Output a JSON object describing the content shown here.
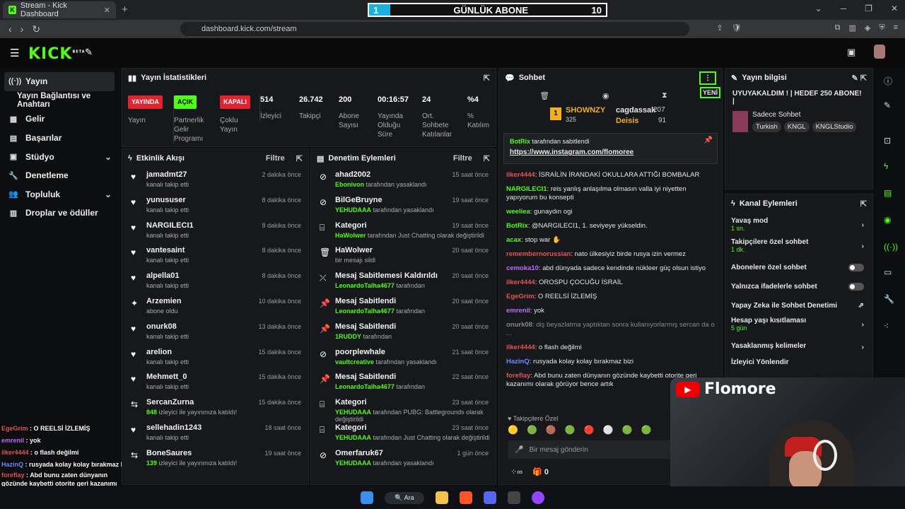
{
  "browser": {
    "tab_title": "Stream - Kick Dashboard",
    "url": "dashboard.kick.com/stream"
  },
  "overlay_banner": {
    "progress": "1",
    "title": "GÜNLÜK ABONE",
    "goal": "10"
  },
  "header": {
    "logo": "KICK",
    "beta": "BETA"
  },
  "nav": {
    "items": [
      {
        "label": "Yayın",
        "icon": "broadcast-icon"
      },
      {
        "label": "Yayın Bağlantısı ve Anahtarı"
      },
      {
        "label": "Gelir",
        "icon": "revenue-icon"
      },
      {
        "label": "Başarılar",
        "icon": "achievements-icon"
      },
      {
        "label": "Stüdyo",
        "icon": "studio-icon"
      },
      {
        "label": "Denetleme",
        "icon": "moderation-icon"
      },
      {
        "label": "Topluluk",
        "icon": "community-icon"
      },
      {
        "label": "Droplar ve ödüller",
        "icon": "drops-icon"
      }
    ]
  },
  "stats": {
    "title": "Yayın İstatistikleri",
    "items": [
      {
        "badge": "YAYINDA",
        "label": "Yayın"
      },
      {
        "badge": "AÇIK",
        "label": "Partnerlik Gelir Programı"
      },
      {
        "badge": "KAPALI",
        "label": "Çoklu Yayın"
      },
      {
        "value": "514",
        "label": "İzleyici"
      },
      {
        "value": "26.742",
        "label": "Takipçi"
      },
      {
        "value": "200",
        "label": "Abone Sayısı"
      },
      {
        "value": "00:16:57",
        "label": "Yayında Olduğu Süre"
      },
      {
        "value": "24",
        "label": "Ort. Sohbete Katılanlar"
      },
      {
        "value": "%4",
        "label": "% Katılım"
      }
    ]
  },
  "activity": {
    "title": "Etkinlik Akışı",
    "filter": "Filtre",
    "rows": [
      {
        "name": "jamadmt27",
        "sub": "kanalı takip etti",
        "time": "2 dakika önce"
      },
      {
        "name": "yunususer",
        "sub": "kanalı takip etti",
        "time": "8 dakika önce"
      },
      {
        "name": "NARGILECI1",
        "sub": "kanalı takip etti",
        "time": "8 dakika önce"
      },
      {
        "name": "vantesaint",
        "sub": "kanalı takip etti",
        "time": "8 dakika önce"
      },
      {
        "name": "alpella01",
        "sub": "kanalı takip etti",
        "time": "8 dakika önce"
      },
      {
        "name": "Arzemien",
        "sub": "abone oldu",
        "time": "10 dakika önce"
      },
      {
        "name": "onurk08",
        "sub": "kanalı takip etti",
        "time": "13 dakika önce"
      },
      {
        "name": "arelion",
        "sub": "kanalı takip etti",
        "time": "15 dakika önce"
      },
      {
        "name": "Mehmett_0",
        "sub": "kanalı takip etti",
        "time": "15 dakika önce"
      },
      {
        "name": "SercanZurna",
        "sub_hl": "848",
        "sub": " izleyici ile yayınınıza katıldı!",
        "time": "15 dakika önce"
      },
      {
        "name": "sellehadin1243",
        "sub": "kanalı takip etti",
        "time": "18 saat önce"
      },
      {
        "name": "BoneSaures",
        "sub_hl": "139",
        "sub": " izleyici ile yayınınıza katıldı!",
        "time": "19 saat önce"
      }
    ]
  },
  "modlog": {
    "title": "Denetim Eylemleri",
    "filter": "Filtre",
    "rows": [
      {
        "name": "ahad2002",
        "hl": "Ebonivon",
        "sub": " tarafından yasaklandı",
        "time": "15 saat önce"
      },
      {
        "name": "BilGeBruyne",
        "hl": "YEHUDAAA",
        "sub": " tarafından yasaklandı",
        "time": "19 saat önce"
      },
      {
        "name": "Kategori",
        "hl": "HaWolwer",
        "sub": " tarafından Just Chatting olarak değiştirildi",
        "time": "19 saat önce"
      },
      {
        "name": "HaWolwer",
        "hl": "",
        "sub": "bir mesajı sildi",
        "time": "20 saat önce"
      },
      {
        "name": "Mesaj Sabitlemesi Kaldırıldı",
        "hl": "LeonardoTalha4677",
        "sub": " tarafından",
        "time": "20 saat önce"
      },
      {
        "name": "Mesaj Sabitlendi",
        "hl": "LeonardoTalha4677",
        "sub": " tarafından",
        "time": "20 saat önce"
      },
      {
        "name": "Mesaj Sabitlendi",
        "hl": "1RUDDY",
        "sub": " tarafından",
        "time": "20 saat önce"
      },
      {
        "name": "poorplewhale",
        "hl": "vaultcreative",
        "sub": " tarafından yasaklandı",
        "time": "21 saat önce"
      },
      {
        "name": "Mesaj Sabitlendi",
        "hl": "LeonardoTalha4677",
        "sub": " tarafından",
        "time": "22 saat önce"
      },
      {
        "name": "Kategori",
        "hl": "YEHUDAAA",
        "sub": " tarafından PUBG: Battlegrounds olarak değiştirildi",
        "time": "23 saat önce"
      },
      {
        "name": "Kategori",
        "hl": "YEHUDAAA",
        "sub": " tarafından Just Chatting olarak değiştirildi",
        "time": "23 saat önce"
      },
      {
        "name": "Omerfaruk67",
        "hl": "YEHUDAAA",
        "sub": " tarafından yasaklandı",
        "time": "1 gün önce"
      }
    ]
  },
  "chat": {
    "title": "Sohbet",
    "new_label": "YENİ",
    "leader1": {
      "rank": "1",
      "name": "SHOWNZY",
      "value": "325"
    },
    "leader2": {
      "name": "cagdassak",
      "value": "207"
    },
    "leader3": {
      "name": "Deisis",
      "value": "91"
    },
    "pinned_by": "BotRix",
    "pinned_label": "tarafından sabitlendi",
    "pinned_link": "https://www.instagram.com/flomoree",
    "messages": [
      {
        "user": "ilker4444",
        "color": "#e25555",
        "text": "İSRAİLİN İRANDAKİ OKULLARA ATTIĞI BOMBALAR"
      },
      {
        "user": "NARGILECI1",
        "color": "#53fc18",
        "text": "reis yanlış anlaşılma olmasın valla iyi niyetten yapıyorum bu konsepti"
      },
      {
        "user": "weeliea",
        "color": "#53fc18",
        "text": "gunaydın ogi"
      },
      {
        "user": "BotRix",
        "color": "#53fc18",
        "text": "@NARGILECI1, 1. seviyeye yükseldin."
      },
      {
        "user": "acax",
        "color": "#53fc18",
        "text": "stop war ✋"
      },
      {
        "user": "remembernorussian",
        "color": "#e25555",
        "text": "nato ülkesiyiz birde rusya izin vermez"
      },
      {
        "user": "cemoka10",
        "color": "#c36bff",
        "text": "abd dünyada sadece kendinde nükleer güç olsun istiyo"
      },
      {
        "user": "ilker4444",
        "color": "#e25555",
        "text": "OROSPU ÇOCUĞU İSRAİL"
      },
      {
        "user": "EgeGrim",
        "color": "#e25555",
        "text": "O REELSİ İZLEMİŞ"
      },
      {
        "user": "emrenil",
        "color": "#c36bff",
        "text": "yok"
      },
      {
        "user": "onurk08",
        "color": "#888",
        "text": "diş beyazlatma yaptıktan sonra kullanıyorlarmış sercan da o ..."
      },
      {
        "user": "ilker4444",
        "color": "#e25555",
        "text": "o flash değilmi"
      },
      {
        "user": "HazinQ",
        "color": "#6b8cff",
        "text": "rusyada kolay kolay bırakmaz bizi"
      },
      {
        "user": "foreflay",
        "color": "#e25555",
        "text": "Abd bunu zaten dünyanın gözünde kaybetti otorite geri kazanımı olarak görüyor bence artık"
      }
    ],
    "followers_only": "Takipçilere Özel",
    "input_placeholder": "Bir mesaj gönderin",
    "count": "0"
  },
  "stream_info": {
    "title": "Yayın bilgisi",
    "stream_title": "UYUYAKALDIM ! | HEDEF 250 ABONE! |",
    "category": "Sadece Sohbet",
    "tags": [
      "Turkish",
      "KNGL",
      "KNGLStudio"
    ]
  },
  "channel_actions": {
    "title": "Kanal Eylemleri",
    "items": [
      {
        "label": "Yavaş mod",
        "sub": "1 sn."
      },
      {
        "label": "Takipçilere özel sohbet",
        "sub": "1 dk."
      },
      {
        "label": "Abonelere özel sohbet"
      },
      {
        "label": "Yalnızca ifadelerle sohbet"
      },
      {
        "label": "Yapay Zeka ile Sohbet Denetimi"
      },
      {
        "label": "Hesap yaşı kısıtlaması",
        "sub": "5 gün"
      },
      {
        "label": "Yasaklanmış kelimeler"
      },
      {
        "label": "İzleyici Yönlendir"
      }
    ]
  },
  "overlay_chat": [
    {
      "user": "EgeGrim",
      "color": "#e25555",
      "text": "O REELSİ İZLEMİŞ"
    },
    {
      "user": "emrenil",
      "color": "#c36bff",
      "text": "yok"
    },
    {
      "user": "ilker4444",
      "color": "#e25555",
      "text": "o flash değilmi"
    },
    {
      "user": "HazinQ",
      "color": "#6b8cff",
      "text": "rusyada kolay kolay bırakmaz bizi"
    },
    {
      "user": "foreflay",
      "color": "#e25555",
      "text": "Abd bunu zaten dünyanın gözünde kaybetti otorite geri kazanımı olarak görüyor bence artık"
    }
  ],
  "webcam": {
    "name": "Flomore"
  },
  "taskbar": {
    "search": "Ara"
  },
  "colors": {
    "accent": "#53fc18",
    "live_red": "#e0242f"
  }
}
